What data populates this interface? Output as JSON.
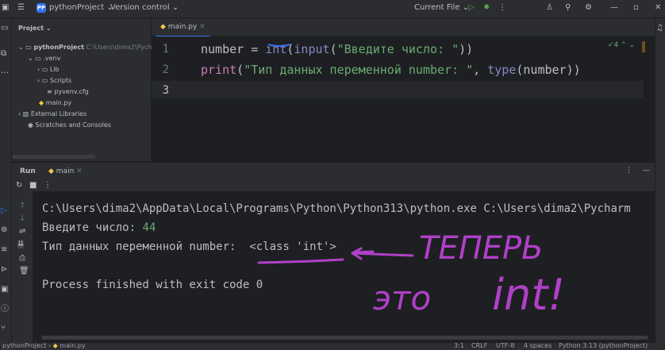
{
  "titlebar": {
    "project_badge": "PP",
    "project_name": "pythonProject",
    "vcs": "Version control",
    "run_config": "Current File"
  },
  "project_panel": {
    "title": "Project",
    "root_name": "pythonProject",
    "root_path": "C:\\Users\\dima2\\Pych",
    "items": [
      {
        "label": ".venv"
      },
      {
        "label": "Lib"
      },
      {
        "label": "Scripts"
      },
      {
        "label": "pyvenv.cfg"
      },
      {
        "label": "main.py"
      },
      {
        "label": "External Libraries"
      },
      {
        "label": "Scratches and Consoles"
      }
    ]
  },
  "editor": {
    "tab_label": "main.py",
    "inspection": "4",
    "lines": [
      {
        "num": "1",
        "code": "number = int(input(\"Введите число: \"))"
      },
      {
        "num": "2",
        "code": "print(\"Тип данных переменной number: \", type(number))"
      },
      {
        "num": "3",
        "code": ""
      }
    ]
  },
  "run_panel": {
    "tab_run": "Run",
    "tab_config": "main",
    "console_lines": [
      "C:\\Users\\dima2\\AppData\\Local\\Programs\\Python\\Python313\\python.exe C:\\Users\\dima2\\Pycharm",
      "Введите число: ",
      "Тип данных переменной number:  <class 'int'>",
      "",
      "Process finished with exit code 0"
    ],
    "input_value": "44"
  },
  "annotation": {
    "line1": "ТЕПЕРЬ",
    "line2": "это",
    "line3": "int!"
  },
  "statusbar": {
    "breadcrumb_project": "pythonProject",
    "breadcrumb_file": "main.py",
    "position": "3:1",
    "line_sep": "CRLF",
    "encoding": "UTF-8",
    "indent": "4 spaces",
    "interpreter": "Python 3.13 (pythonProject)"
  },
  "colors": {
    "background": "#1e1f22",
    "panel": "#2b2d30",
    "keyword_purple": "#c77dbb",
    "string_green": "#6aab73",
    "builtin": "#8888c6",
    "annotation_ink": "#b040c8"
  }
}
